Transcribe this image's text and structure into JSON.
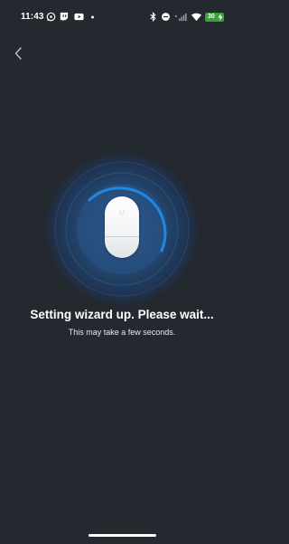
{
  "status_bar": {
    "time": "11:43",
    "icons": [
      "whatsapp-icon",
      "twitch-icon",
      "youtube-icon",
      "dot-icon",
      "bluetooth-icon",
      "do-not-disturb-icon",
      "signal-icon",
      "wifi-icon"
    ],
    "battery": "30"
  },
  "nav": {
    "back_icon": "chevron-left-icon"
  },
  "wizard": {
    "title": "Setting wizard up. Please wait...",
    "subtitle": "This may take a few seconds.",
    "progress_arc_color": "#1e88e5"
  },
  "colors": {
    "background": "#24282f",
    "accent": "#1e88e5",
    "battery": "#3aa13a"
  }
}
